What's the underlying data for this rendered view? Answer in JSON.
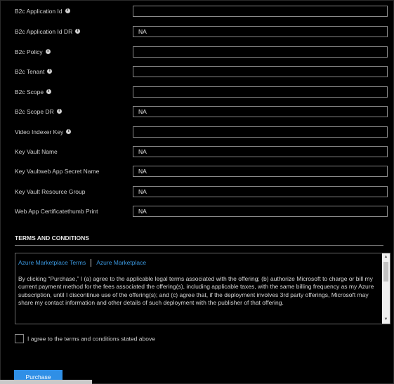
{
  "fields": [
    {
      "label": "B2c Application Id",
      "info": true,
      "value": ""
    },
    {
      "label": "B2c Application Id DR",
      "info": true,
      "value": "NA"
    },
    {
      "label": "B2c Policy",
      "info": true,
      "value": ""
    },
    {
      "label": "B2c Tenant",
      "info": true,
      "value": ""
    },
    {
      "label": "B2c Scope",
      "info": true,
      "value": ""
    },
    {
      "label": "B2c Scope DR",
      "info": true,
      "value": "NA"
    },
    {
      "label": "Video Indexer Key",
      "info": true,
      "value": ""
    },
    {
      "label": "Key Vault Name",
      "info": false,
      "value": "NA"
    },
    {
      "label": "Key Vaultweb App Secret Name",
      "info": false,
      "value": "NA"
    },
    {
      "label": "Key Vault Resource Group",
      "info": false,
      "value": "NA"
    },
    {
      "label": "Web App Certificatethumb Print",
      "info": false,
      "value": "NA"
    }
  ],
  "info_icon": "info-icon",
  "terms": {
    "title": "TERMS AND CONDITIONS",
    "links": [
      "Azure Marketplace Terms",
      "Azure Marketplace"
    ],
    "text": "By clicking “Purchase,” I (a) agree to the applicable legal terms associated with the offering; (b) authorize Microsoft to charge or bill my current payment method for the fees associated the offering(s), including applicable taxes, with the same billing frequency as my Azure subscription, until I discontinue use of the offering(s); and (c) agree that, if the deployment involves 3rd party offerings, Microsoft may share my contact information and other details of such deployment with the publisher of that offering.",
    "agree_label": "I agree to the terms and conditions stated above",
    "agree_checked": false
  },
  "purchase_label": "Purchase",
  "colors": {
    "background": "#000000",
    "link": "#3a96dd",
    "button": "#2f8fe6"
  }
}
